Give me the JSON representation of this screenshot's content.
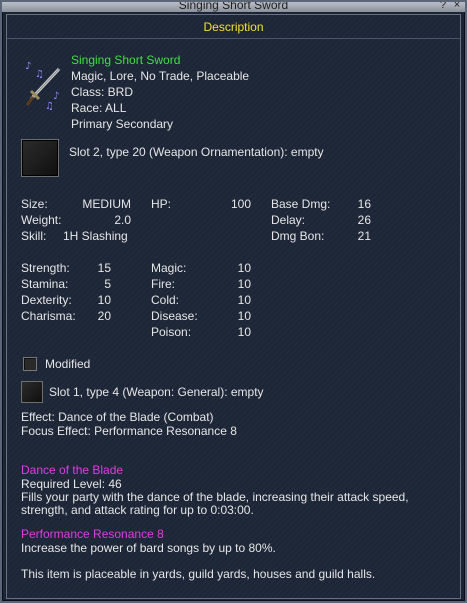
{
  "window": {
    "title": "Singing Short Sword",
    "help_label": "?",
    "close_label": "×"
  },
  "header": {
    "label": "Description"
  },
  "item": {
    "name": "Singing Short Sword",
    "flags": "Magic, Lore, No Trade, Placeable",
    "class": "Class: BRD",
    "race": "Race: ALL",
    "slots": "Primary Secondary"
  },
  "aug_slot_2": "Slot 2, type 20 (Weapon Ornamentation): empty",
  "stats": {
    "size_label": "Size:",
    "size_value": "MEDIUM",
    "weight_label": "Weight:",
    "weight_value": "2.0",
    "skill_label": "Skill:",
    "skill_value": "1H Slashing",
    "hp_label": "HP:",
    "hp_value": "100",
    "basedmg_label": "Base Dmg:",
    "basedmg_value": "16",
    "delay_label": "Delay:",
    "delay_value": "26",
    "dmgbon_label": "Dmg Bon:",
    "dmgbon_value": "21"
  },
  "attributes": [
    {
      "label": "Strength:",
      "value": "15"
    },
    {
      "label": "Stamina:",
      "value": "5"
    },
    {
      "label": "Dexterity:",
      "value": "10"
    },
    {
      "label": "Charisma:",
      "value": "20"
    }
  ],
  "resists": [
    {
      "label": "Magic:",
      "value": "10"
    },
    {
      "label": "Fire:",
      "value": "10"
    },
    {
      "label": "Cold:",
      "value": "10"
    },
    {
      "label": "Disease:",
      "value": "10"
    },
    {
      "label": "Poison:",
      "value": "10"
    }
  ],
  "modified_label": "Modified",
  "aug_slot_1": "Slot 1, type 4 (Weapon: General): empty",
  "effect": "Effect: Dance of the Blade (Combat)",
  "focus_effect": "Focus Effect: Performance Resonance 8",
  "spell1": {
    "name": "Dance of the Blade",
    "req": "Required Level: 46",
    "desc1": "Fills your party with the dance of the blade, increasing their attack speed,",
    "desc2": "strength, and attack rating for up to 0:03:00."
  },
  "spell2": {
    "name": "Performance Resonance 8",
    "desc": "Increase the power of bard songs by up to 80%."
  },
  "placeable_note": "This item is placeable in yards, guild yards, houses and guild halls.",
  "colors": {
    "name_green": "#3ee03e",
    "spell_magenta": "#e23ce2",
    "header_yellow": "#f2e230"
  },
  "icons": {
    "item_icon": "singing-sword-icon"
  }
}
